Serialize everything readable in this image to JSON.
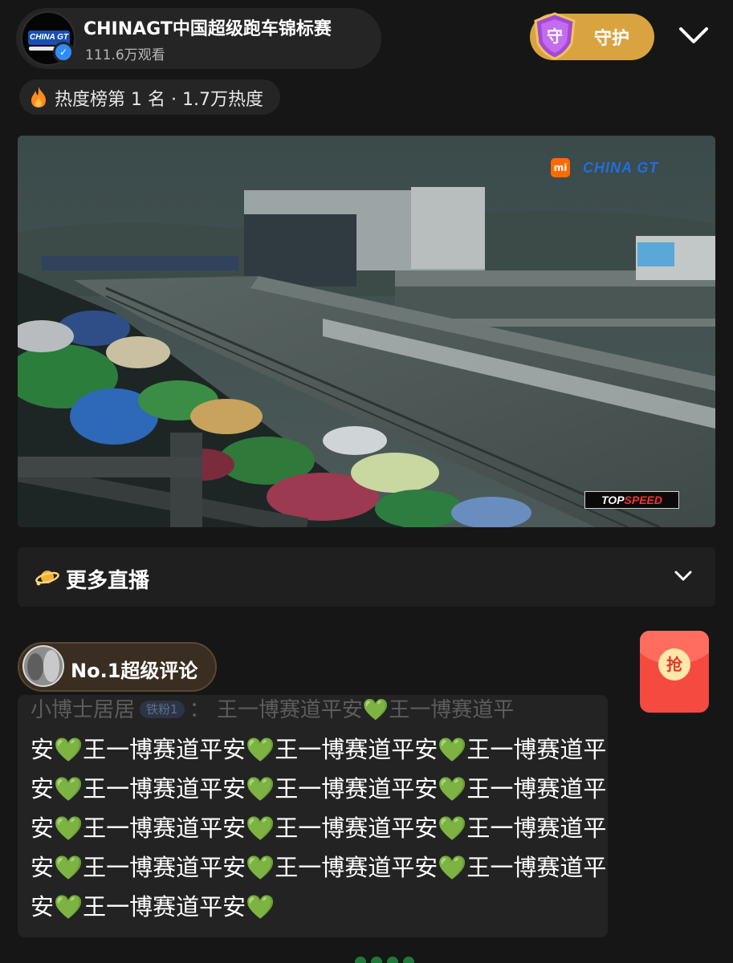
{
  "header": {
    "avatar_logo": "CHINA GT",
    "title": "CHINAGT中国超级跑车锦标赛",
    "viewers": "111.6万观看",
    "guard_icon_char": "守",
    "guard_label": "守护",
    "collapse_icon": "chevron-down-icon"
  },
  "heat": {
    "text": "热度榜第 1 名 · 1.7万热度",
    "icon": "fire-icon"
  },
  "video": {
    "brand_logo": "mi",
    "brand_text": "CHINA GT",
    "overlay_top": "TOP",
    "overlay_speed": "SPEED"
  },
  "more_live": {
    "label": "更多直播",
    "icon": "planet-icon"
  },
  "top_comment": {
    "badge_label": "No.1超级评论",
    "username": "小博士居居",
    "fan_badge": "铁粉1",
    "header_text": "： 王一博赛道平安💚王一博赛道平",
    "body": "安💚王一博赛道平安💚王一博赛道平安💚王一博赛道平安💚王一博赛道平安💚王一博赛道平安💚王一博赛道平安💚王一博赛道平安💚王一博赛道平安💚王一博赛道平安💚王一博赛道平安💚王一博赛道平安💚王一博赛道平安💚王一博赛道平安💚"
  },
  "red_packet": {
    "label": "抢"
  },
  "colors": {
    "background": "#161616",
    "gold": "#d9a440",
    "red_packet": "#f44a3f",
    "heart": "#3cc23c"
  }
}
